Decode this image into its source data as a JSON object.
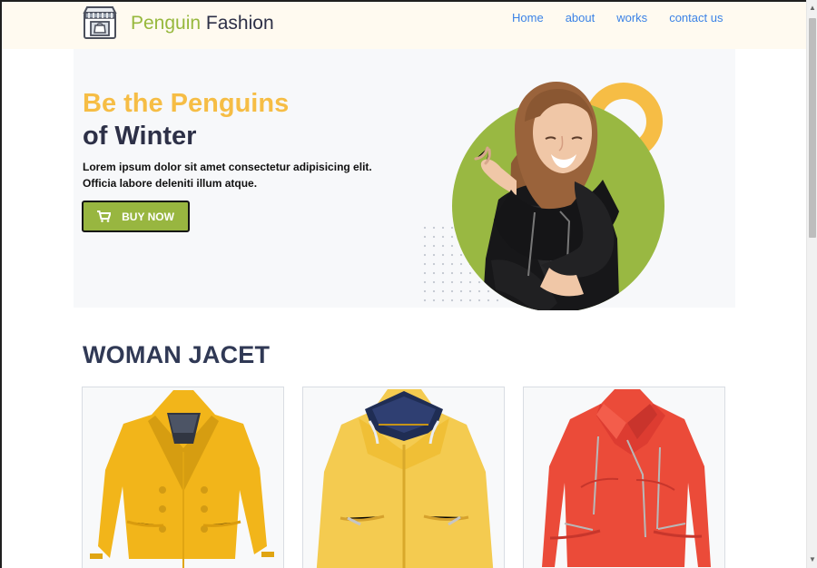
{
  "brand": {
    "name_part1": "Penguin",
    "name_part2": "Fashion",
    "logo_icon": "store-icon"
  },
  "nav": {
    "items": [
      {
        "label": "Home"
      },
      {
        "label": "about"
      },
      {
        "label": "works"
      },
      {
        "label": "contact us"
      }
    ]
  },
  "hero": {
    "title_line1": "Be the Penguins",
    "title_line2": "of Winter",
    "description": "Lorem ipsum dolor sit amet consectetur adipisicing elit. Officia labore deleniti illum atque.",
    "cta_label": "BUY NOW",
    "cta_icon": "shopping-cart-icon",
    "image_subject": "woman-in-black-leather-jacket"
  },
  "section": {
    "title": "WOMAN JACET"
  },
  "cards": [
    {
      "product_icon": "yellow-coat-image",
      "color": "#f2b51a"
    },
    {
      "product_icon": "yellow-raincoat-image",
      "color": "#f5cb48"
    },
    {
      "product_icon": "red-leather-jacket-image",
      "color": "#eb4b39"
    }
  ],
  "colors": {
    "accent_green": "#98b640",
    "accent_yellow": "#f6bd45",
    "dark_text": "#2d3047",
    "nav_link": "#3b82e6",
    "header_bg": "#fffaf0"
  }
}
